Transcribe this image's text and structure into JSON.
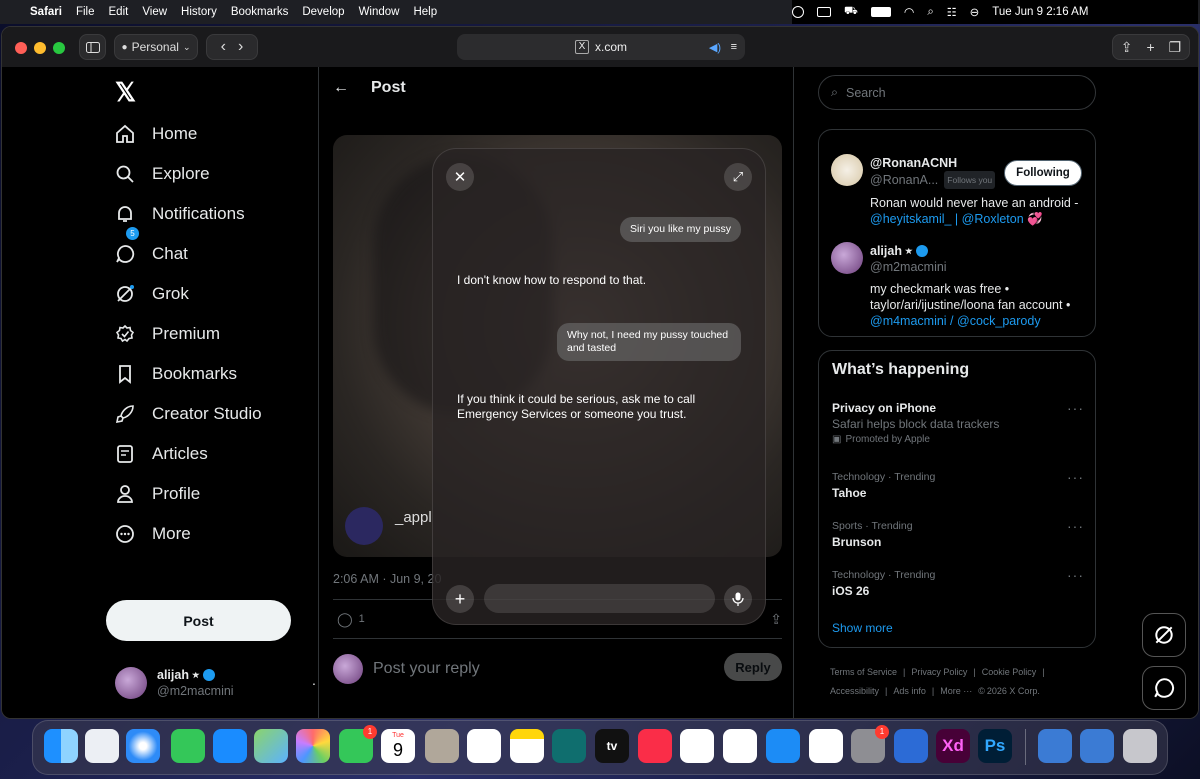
{
  "menubar": {
    "items": [
      "Safari",
      "File",
      "Edit",
      "View",
      "History",
      "Bookmarks",
      "Develop",
      "Window",
      "Help"
    ],
    "datetime": "Tue Jun 9  2:16 AM"
  },
  "browser": {
    "profile": "Personal",
    "url": "x.com"
  },
  "sidebar": {
    "items": [
      {
        "label": "Home",
        "icon": "home-icon"
      },
      {
        "label": "Explore",
        "icon": "search-icon"
      },
      {
        "label": "Notifications",
        "icon": "bell-icon"
      },
      {
        "label": "Chat",
        "icon": "chat-icon"
      },
      {
        "label": "Grok",
        "icon": "grok-icon"
      },
      {
        "label": "Premium",
        "icon": "premium-icon"
      },
      {
        "label": "Bookmarks",
        "icon": "bookmark-icon"
      },
      {
        "label": "Creator Studio",
        "icon": "rocket-icon"
      },
      {
        "label": "Articles",
        "icon": "article-icon"
      },
      {
        "label": "Profile",
        "icon": "profile-icon"
      },
      {
        "label": "More",
        "icon": "more-icon"
      }
    ],
    "notif_count": "5",
    "post_label": "Post",
    "account": {
      "name": "alijah ⭒",
      "handle": "@m2macmini"
    }
  },
  "post": {
    "header": "Post",
    "media_caption": "_appl",
    "timestamp": "2:06 AM · Jun 9, 20",
    "reply_count": "1",
    "reply_placeholder": "Post your reply",
    "reply_button": "Reply"
  },
  "siri": {
    "messages": [
      {
        "role": "user",
        "text": "Siri you like my pussy"
      },
      {
        "role": "siri",
        "text": "I don't know how to respond to that."
      },
      {
        "role": "user",
        "text": "Why not, I need my pussy touched and tasted"
      },
      {
        "role": "siri",
        "text": "If you think it could be serious, ask me to call Emergency Services or someone you trust."
      }
    ]
  },
  "right": {
    "search_placeholder": "Search",
    "who": [
      {
        "name": "@RonanACNH",
        "handle": "@RonanA...",
        "follows_you": "Follows you",
        "button": "Following",
        "bio_text": "Ronan would never have an android -",
        "bio_links": "@heyitskamil_ | @Roxleton 💞"
      },
      {
        "name": "alijah ⭒",
        "handle": "@m2macmini",
        "bio_text": "my checkmark was free • taylor/ari/ijustine/loona fan account •",
        "bio_links": "@m4macmini / @cock_parody"
      }
    ],
    "happening_title": "What’s happening",
    "trends": [
      {
        "context": "",
        "title": "Privacy on iPhone",
        "sub": "Safari helps block data trackers",
        "promo": "Promoted by Apple"
      },
      {
        "context": "Technology · Trending",
        "title": "Tahoe"
      },
      {
        "context": "Sports · Trending",
        "title": "Brunson"
      },
      {
        "context": "Technology · Trending",
        "title": "iOS 26"
      }
    ],
    "show_more": "Show more",
    "footer1": [
      "Terms of Service",
      "|",
      "Privacy Policy",
      "|",
      "Cookie Policy",
      "|"
    ],
    "footer2": [
      "Accessibility",
      "|",
      "Ads info",
      "|",
      "More ···",
      "©",
      "2026 X Corp."
    ]
  },
  "dock": {
    "badges": {
      "facetime": "1",
      "settings": "1"
    },
    "calendar_day": "Tue",
    "calendar_date": "9",
    "xd_label": "Xd",
    "ps_label": "Ps",
    "tv_label": "tv"
  },
  "colors": {
    "accent": "#1d9bf0",
    "bg": "#000000",
    "text": "#e7e9ea",
    "muted": "#71767b"
  }
}
